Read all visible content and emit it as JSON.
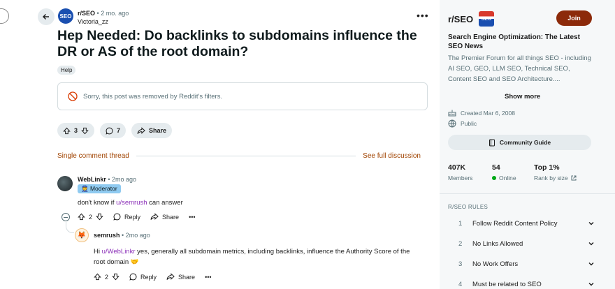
{
  "post": {
    "subreddit": "r/SEO",
    "subreddit_icon_text": "SEO",
    "time": "2 mo. ago",
    "author": "Victoria_zz",
    "title": "Hep Needed: Do backlinks to subdomains influence the DR or AS of the root domain?",
    "flair": "Help",
    "removed_notice": "Sorry, this post was removed by Reddit's filters.",
    "vote_count": "3",
    "comment_count": "7",
    "share_label": "Share"
  },
  "thread": {
    "single_label": "Single comment thread",
    "full_label": "See full discussion"
  },
  "comment1": {
    "author": "WebLinkr",
    "time": "2mo ago",
    "badge": "Moderator",
    "body_prefix": "don't know if ",
    "body_link": "u/semrush",
    "body_suffix": " can answer",
    "votes": "2",
    "reply_label": "Reply",
    "share_label": "Share"
  },
  "comment2": {
    "author": "semrush",
    "time": "2mo ago",
    "body_prefix": "Hi ",
    "body_link": "u/WebLinkr",
    "body_suffix": " yes, generally all subdomain metrics, including backlinks, influence the Authority Score of the root domain 🤝",
    "votes": "2",
    "reply_label": "Reply",
    "share_label": "Share"
  },
  "sidebar": {
    "name": "r/SEO",
    "icon_text": "SEO",
    "join_label": "Join",
    "tagline": "Search Engine Optimization: The Latest SEO News",
    "description": "The Premier Forum for all things SEO - including AI SEO, GEO, LLM SEO, Technical SEO, Content SEO and SEO Architecture....",
    "show_more": "Show more",
    "created": "Created Mar 6, 2008",
    "visibility": "Public",
    "guide_label": "Community Guide",
    "members_value": "407K",
    "members_label": "Members",
    "online_value": "54",
    "online_label": "Online",
    "rank_value": "Top 1%",
    "rank_label": "Rank by size",
    "rules_header": "R/SEO RULES",
    "rules": [
      {
        "num": "1",
        "text": "Follow Reddit Content Policy"
      },
      {
        "num": "2",
        "text": "No Links Allowed"
      },
      {
        "num": "3",
        "text": "No Work Offers"
      },
      {
        "num": "4",
        "text": "Must be related to SEO"
      }
    ]
  },
  "colors": {
    "join_button": "#8c2a0a",
    "thread_link": "#a04300",
    "user_link": "#8b2fb8",
    "online_dot": "#01a816"
  }
}
